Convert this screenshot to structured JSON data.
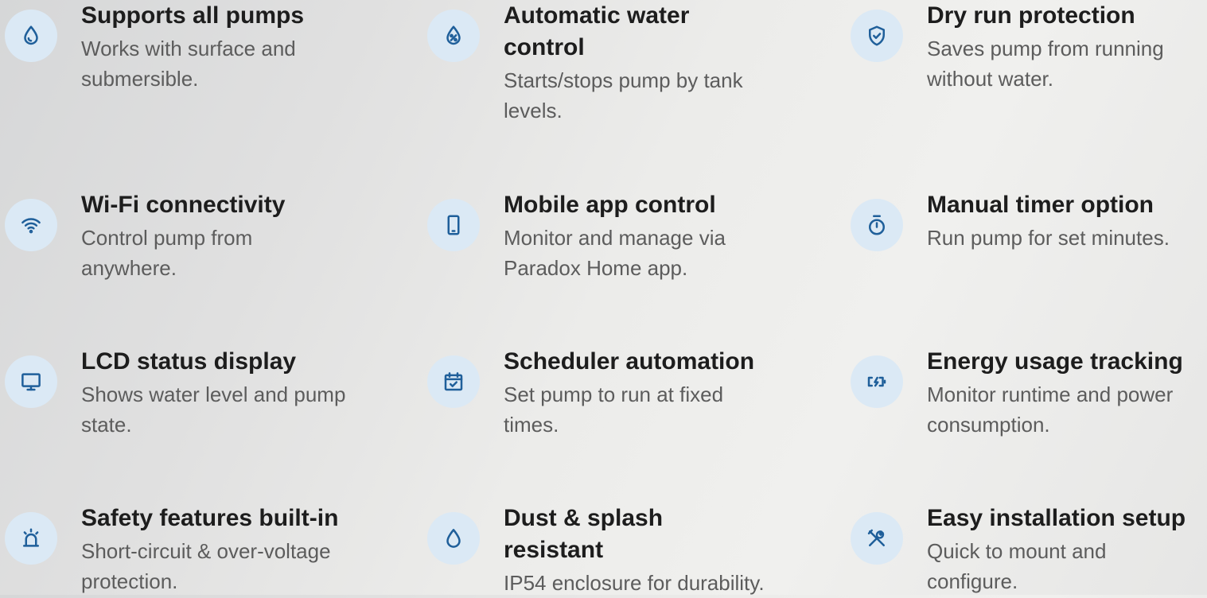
{
  "colors": {
    "icon_background": "#dbe9f5",
    "icon_stroke": "#1f5f9a",
    "title": "#1d1d1d",
    "description": "#5c5c5c"
  },
  "features": [
    {
      "icon": "water-drop-icon",
      "title": "Supports all pumps",
      "description": "Works with surface and submersible."
    },
    {
      "icon": "drop-percent-icon",
      "title": "Automatic water control",
      "description": "Starts/stops pump by tank levels."
    },
    {
      "icon": "shield-check-icon",
      "title": "Dry run protection",
      "description": "Saves pump from running without water."
    },
    {
      "icon": "wifi-icon",
      "title": "Wi-Fi connectivity",
      "description": "Control pump from anywhere."
    },
    {
      "icon": "smartphone-icon",
      "title": "Mobile app control",
      "description": "Monitor and manage via Paradox Home app."
    },
    {
      "icon": "timer-icon",
      "title": "Manual timer option",
      "description": "Run pump for set minutes."
    },
    {
      "icon": "monitor-icon",
      "title": "LCD status display",
      "description": "Shows water level and pump state."
    },
    {
      "icon": "calendar-check-icon",
      "title": "Scheduler automation",
      "description": "Set pump to run at fixed times."
    },
    {
      "icon": "battery-charging-icon",
      "title": "Energy usage tracking",
      "description": "Monitor runtime and power consumption."
    },
    {
      "icon": "alarm-siren-icon",
      "title": "Safety features built-in",
      "description": "Short-circuit & over-voltage protection."
    },
    {
      "icon": "droplet-outline-icon",
      "title": "Dust & splash resistant",
      "description": "IP54 enclosure for durability."
    },
    {
      "icon": "tools-icon",
      "title": "Easy installation setup",
      "description": "Quick to mount and configure."
    }
  ]
}
